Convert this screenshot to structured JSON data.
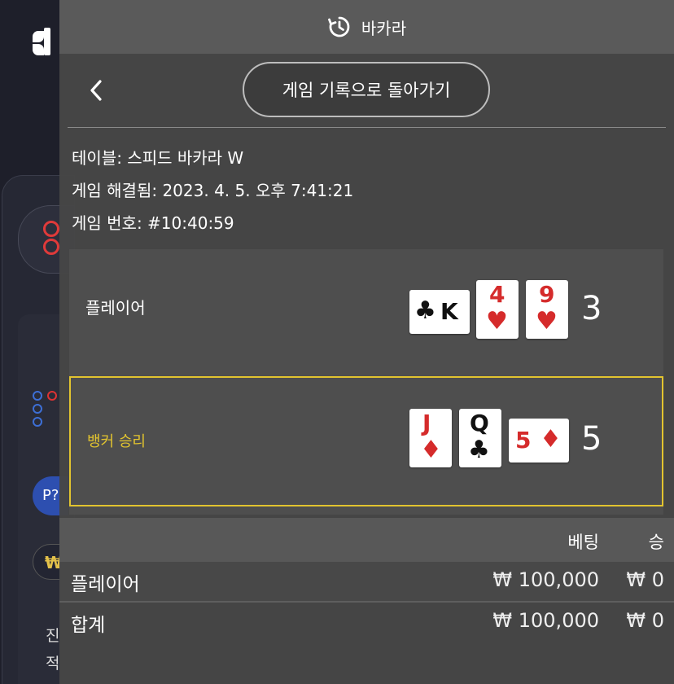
{
  "header": {
    "title": "바카라",
    "icon": "history-icon"
  },
  "nav": {
    "back_icon": "chevron-left-icon",
    "return_label": "게임 기록으로 돌아가기"
  },
  "game_info": {
    "table": "테이블: 스피드 바카라 W",
    "resolved": "게임 해결됨: 2023. 4. 5. 오후 7:41:21",
    "number": "게임 번호: #10:40:59"
  },
  "result": {
    "player": {
      "label": "플레이어",
      "score": "3",
      "cards": [
        {
          "rank": "K",
          "suit": "♣",
          "color": "black",
          "orientation": "horizontal"
        },
        {
          "rank": "4",
          "suit": "♥",
          "color": "red",
          "orientation": "vertical"
        },
        {
          "rank": "9",
          "suit": "♥",
          "color": "red",
          "orientation": "vertical"
        }
      ]
    },
    "banker": {
      "label": "뱅커 승리",
      "score": "5",
      "cards": [
        {
          "rank": "J",
          "suit": "♦",
          "color": "red",
          "orientation": "vertical"
        },
        {
          "rank": "Q",
          "suit": "♣",
          "color": "black",
          "orientation": "vertical"
        },
        {
          "rank": "5",
          "suit": "♦",
          "color": "red",
          "orientation": "horizontal"
        }
      ]
    },
    "highlight_color": "#e2c42f"
  },
  "bets": {
    "headers": {
      "bet": "베팅",
      "win": "승"
    },
    "rows": [
      {
        "label": "플레이어",
        "bet": "₩ 100,000",
        "win": "₩ 0"
      },
      {
        "label": "합계",
        "bet": "₩ 100,000",
        "win": "₩ 0"
      }
    ]
  },
  "background": {
    "chip_label": "P?",
    "currency_symbol": "₩",
    "line1": "진",
    "line2": "적"
  }
}
